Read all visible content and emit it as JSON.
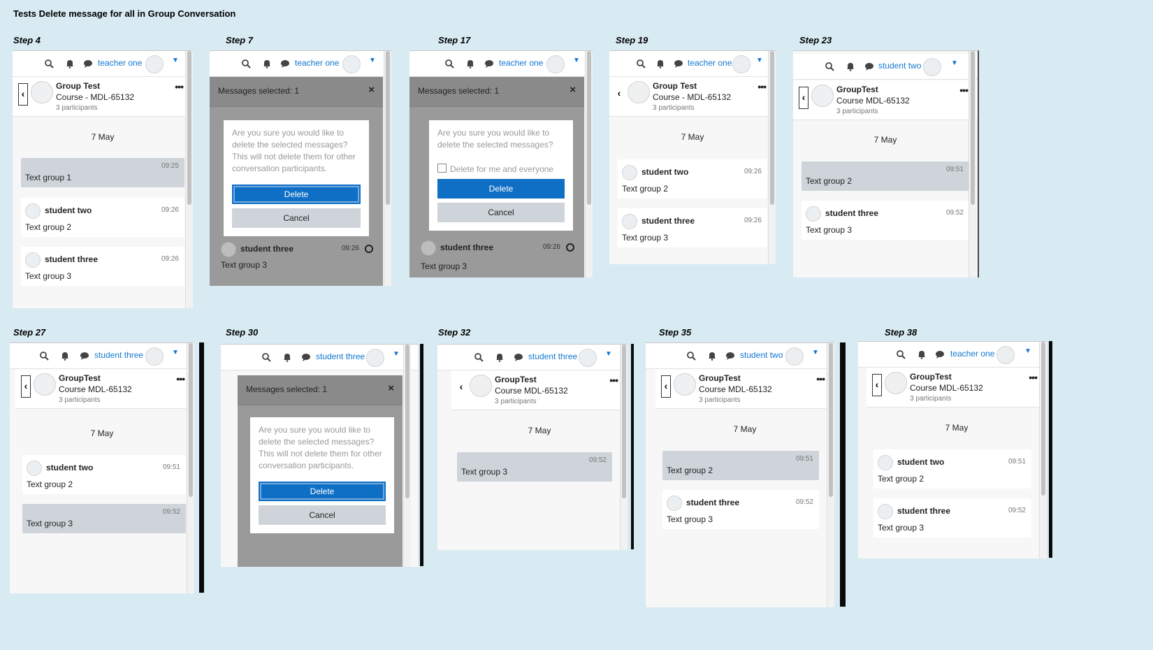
{
  "page": {
    "title": "Tests Delete message for all in Group Conversation"
  },
  "common": {
    "date": "7 May",
    "participants": "3 participants",
    "selected": "Messages selected: 1",
    "delete": "Delete",
    "cancel": "Cancel",
    "confirm": "Are you sure you would like to delete the selected messages? This will not delete them for other conversation participants.",
    "confirm_short": "Are you sure you would like to delete the selected messages?",
    "delete_all": "Delete for me and everyone"
  },
  "steps": {
    "s4": {
      "label": "Step 4",
      "user": "teacher one",
      "group": "Group Test",
      "course": "Course - MDL-65132",
      "m1_time": "09:25",
      "m1_text": "Text group 1",
      "m2_name": "student two",
      "m2_time": "09:26",
      "m2_text": "Text group 2",
      "m3_name": "student three",
      "m3_time": "09:26",
      "m3_text": "Text group 3"
    },
    "s7": {
      "label": "Step 7",
      "user": "teacher one",
      "m_name": "student three",
      "m_time": "09:26",
      "m_text": "Text group 3"
    },
    "s17": {
      "label": "Step 17",
      "user": "teacher one",
      "m_name": "student three",
      "m_time": "09:26",
      "m_text": "Text group 3"
    },
    "s19": {
      "label": "Step 19",
      "user": "teacher one",
      "group": "Group Test",
      "course": "Course - MDL-65132",
      "m1_name": "student two",
      "m1_time": "09:26",
      "m1_text": "Text group 2",
      "m2_name": "student three",
      "m2_time": "09:26",
      "m2_text": "Text group 3"
    },
    "s23": {
      "label": "Step 23",
      "user": "student two",
      "group": "GroupTest",
      "course": "Course MDL-65132",
      "m1_time": "09:51",
      "m1_text": "Text group 2",
      "m2_name": "student three",
      "m2_time": "09:52",
      "m2_text": "Text group 3"
    },
    "s27": {
      "label": "Step 27",
      "user": "student three",
      "group": "GroupTest",
      "course": "Course MDL-65132",
      "m1_name": "student two",
      "m1_time": "09:51",
      "m1_text": "Text group 2",
      "m2_time": "09:52",
      "m2_text": "Text group 3"
    },
    "s30": {
      "label": "Step 30",
      "user": "student three"
    },
    "s32": {
      "label": "Step 32",
      "user": "student three",
      "group": "GroupTest",
      "course": "Course MDL-65132",
      "m1_time": "09:52",
      "m1_text": "Text group 3"
    },
    "s35": {
      "label": "Step 35",
      "user": "student two",
      "group": "GroupTest",
      "course": "Course MDL-65132",
      "m1_time": "09:51",
      "m1_text": "Text group 2",
      "m2_name": "student three",
      "m2_time": "09:52",
      "m2_text": "Text group 3"
    },
    "s38": {
      "label": "Step 38",
      "user": "teacher one",
      "group": "GroupTest",
      "course": "Course MDL-65132",
      "m1_name": "student two",
      "m1_time": "09:51",
      "m1_text": "Text group 2",
      "m2_name": "student three",
      "m2_time": "09:52",
      "m2_text": "Text group 3"
    }
  }
}
